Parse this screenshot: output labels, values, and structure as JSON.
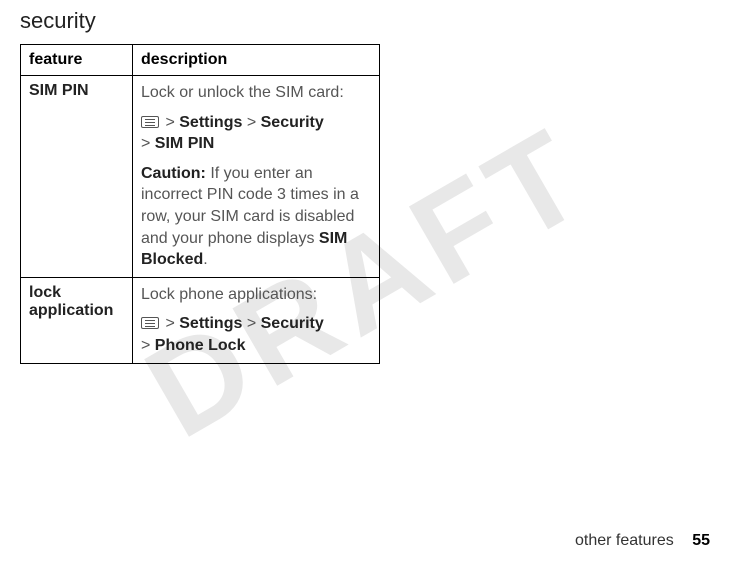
{
  "watermark": "DRAFT",
  "section_title": "security",
  "table": {
    "headers": {
      "feature": "feature",
      "description": "description"
    },
    "rows": [
      {
        "feature": "SIM PIN",
        "desc_intro": "Lock or unlock the SIM card:",
        "path": {
          "sep1": ">",
          "settings": "Settings",
          "sep2": ">",
          "security": "Security",
          "sep3": ">",
          "leaf": "SIM PIN"
        },
        "caution_label": "Caution:",
        "caution_text": " If you enter an incorrect PIN code 3 times in a row, your SIM card is disabled and your phone displays ",
        "caution_tail": "SIM Blocked",
        "caution_period": "."
      },
      {
        "feature": "lock application",
        "desc_intro": "Lock phone applications:",
        "path": {
          "sep1": ">",
          "settings": "Settings",
          "sep2": ">",
          "security": "Security",
          "sep3": ">",
          "leaf": "Phone Lock"
        }
      }
    ]
  },
  "footer": {
    "label": "other features",
    "page": "55"
  }
}
